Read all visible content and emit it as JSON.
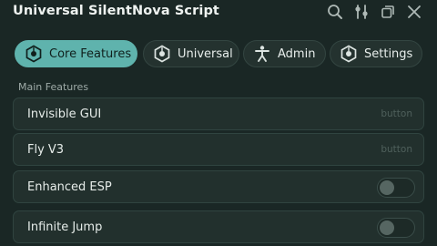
{
  "window": {
    "title": "Universal SilentNova Script",
    "controls": [
      {
        "icon": "search-icon"
      },
      {
        "icon": "sliders-icon"
      },
      {
        "icon": "minimize-icon"
      },
      {
        "icon": "close-icon"
      }
    ]
  },
  "tabs": [
    {
      "label": "Core Features",
      "icon": "feature-icon",
      "active": true
    },
    {
      "label": "Universal",
      "icon": "feature-icon",
      "active": false
    },
    {
      "label": "Admin",
      "icon": "person-icon",
      "active": false
    },
    {
      "label": "Settings",
      "icon": "feature-icon",
      "active": false
    }
  ],
  "section": {
    "label": "Main Features"
  },
  "features": [
    {
      "label": "Invisible GUI",
      "kind": "button",
      "hint": "button"
    },
    {
      "label": "Fly V3",
      "kind": "button",
      "hint": "button"
    },
    {
      "label": "Enhanced ESP",
      "kind": "toggle",
      "enabled": false
    },
    {
      "label": "Infinite Jump",
      "kind": "toggle",
      "enabled": false
    }
  ],
  "colors": {
    "background": "#1a2725",
    "accent": "#5fb3ad",
    "row": "#22302d",
    "row_border": "#304440",
    "hint_text": "#4f605c"
  }
}
